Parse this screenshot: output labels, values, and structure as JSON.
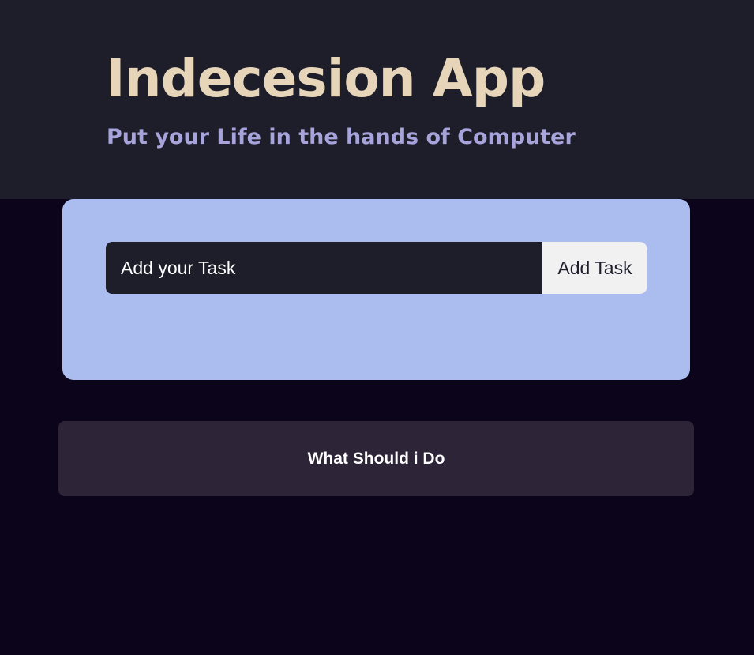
{
  "header": {
    "title": "Indecesion App",
    "subtitle": "Put your Life in the hands of Computer"
  },
  "add_task": {
    "input_value": "",
    "input_placeholder": "Add your Task",
    "button_label": "Add Task"
  },
  "decide": {
    "button_label": "What Should i Do"
  },
  "colors": {
    "page_background": "#0c041b",
    "header_background": "#1e1e2b",
    "title": "#e6d5b8",
    "subtitle": "#a7a4dc",
    "card_background": "#abbcef",
    "input_background": "#1e1e2b",
    "add_button_background": "#f1f1f1",
    "decide_button_background": "#2d2438"
  }
}
